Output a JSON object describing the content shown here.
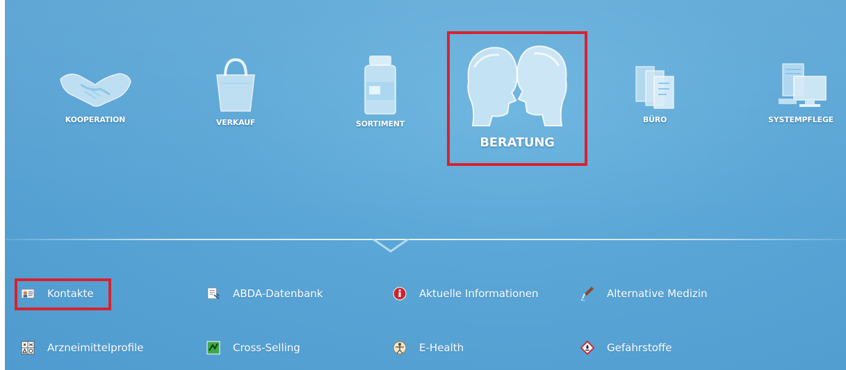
{
  "modules": [
    {
      "label": "KOOPERATION",
      "icon": "handshake-icon"
    },
    {
      "label": "VERKAUF",
      "icon": "shopping-bag-icon"
    },
    {
      "label": "SORTIMENT",
      "icon": "medicine-bottle-icon"
    },
    {
      "label": "BERATUNG",
      "icon": "consultation-heads-icon",
      "selected": true
    },
    {
      "label": "BÜRO",
      "icon": "folders-icon"
    },
    {
      "label": "SYSTEMPFLEGE",
      "icon": "computer-icon"
    }
  ],
  "submenu": [
    {
      "label": "Kontakte",
      "icon": "contact-card-icon",
      "highlighted": true
    },
    {
      "label": "ABDA-Datenbank",
      "icon": "database-document-icon"
    },
    {
      "label": "Aktuelle Informationen",
      "icon": "info-icon"
    },
    {
      "label": "Alternative Medizin",
      "icon": "pipette-icon"
    },
    {
      "label": "Arzneimittelprofile",
      "icon": "profile-grid-icon"
    },
    {
      "label": "Cross-Selling",
      "icon": "cross-selling-icon"
    },
    {
      "label": "E-Health",
      "icon": "vitruvian-man-icon"
    },
    {
      "label": "Gefahrstoffe",
      "icon": "hazard-diamond-icon"
    }
  ],
  "colors": {
    "background": "#5aa6d6",
    "highlight": "#d8222e",
    "text": "#ffffff"
  }
}
